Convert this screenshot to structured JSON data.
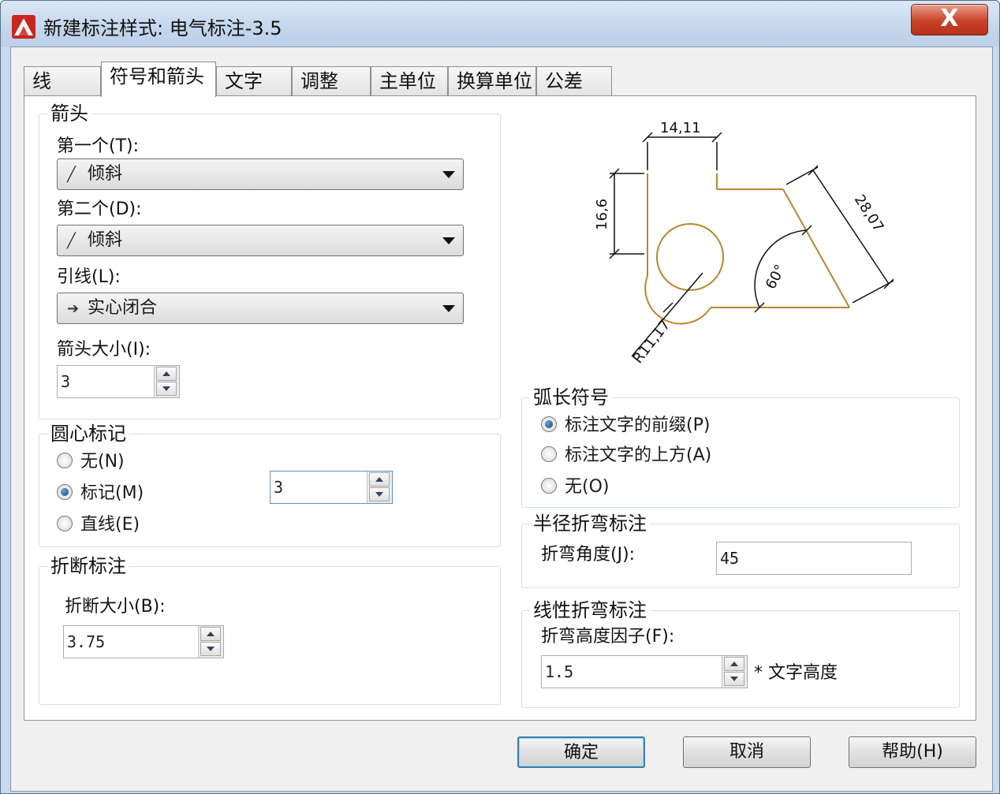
{
  "window": {
    "title": "新建标注样式: 电气标注-3.5",
    "close_label": "X"
  },
  "tabs": [
    {
      "label": "线"
    },
    {
      "label": "符号和箭头"
    },
    {
      "label": "文字"
    },
    {
      "label": "调整"
    },
    {
      "label": "主单位"
    },
    {
      "label": "换算单位"
    },
    {
      "label": "公差"
    }
  ],
  "arrows": {
    "legend": "箭头",
    "first_label": "第一个(T):",
    "first_value": "倾斜",
    "second_label": "第二个(D):",
    "second_value": "倾斜",
    "leader_label": "引线(L):",
    "leader_value": "实心闭合",
    "size_label": "箭头大小(I):",
    "size_value": "3"
  },
  "center_marks": {
    "legend": "圆心标记",
    "options": [
      "无(N)",
      "标记(M)",
      "直线(E)"
    ],
    "selected": "标记(M)",
    "size_value": "3"
  },
  "dim_break": {
    "legend": "折断标注",
    "size_label": "折断大小(B):",
    "size_value": "3.75"
  },
  "preview": {
    "dim_top": "14,11",
    "dim_left": "16,6",
    "dim_right": "28,07",
    "dim_angle": "60°",
    "dim_radius": "R11,17",
    "line_color": "#b8862e"
  },
  "arc_length": {
    "legend": "弧长符号",
    "options": [
      "标注文字的前缀(P)",
      "标注文字的上方(A)",
      "无(O)"
    ],
    "selected": "标注文字的前缀(P)"
  },
  "radius_jog": {
    "legend": "半径折弯标注",
    "angle_label": "折弯角度(J):",
    "angle_value": "45"
  },
  "linear_jog": {
    "legend": "线性折弯标注",
    "factor_label": "折弯高度因子(F):",
    "factor_value": "1.5",
    "suffix": "* 文字高度"
  },
  "buttons": {
    "ok": "确定",
    "cancel": "取消",
    "help": "帮助(H)"
  }
}
